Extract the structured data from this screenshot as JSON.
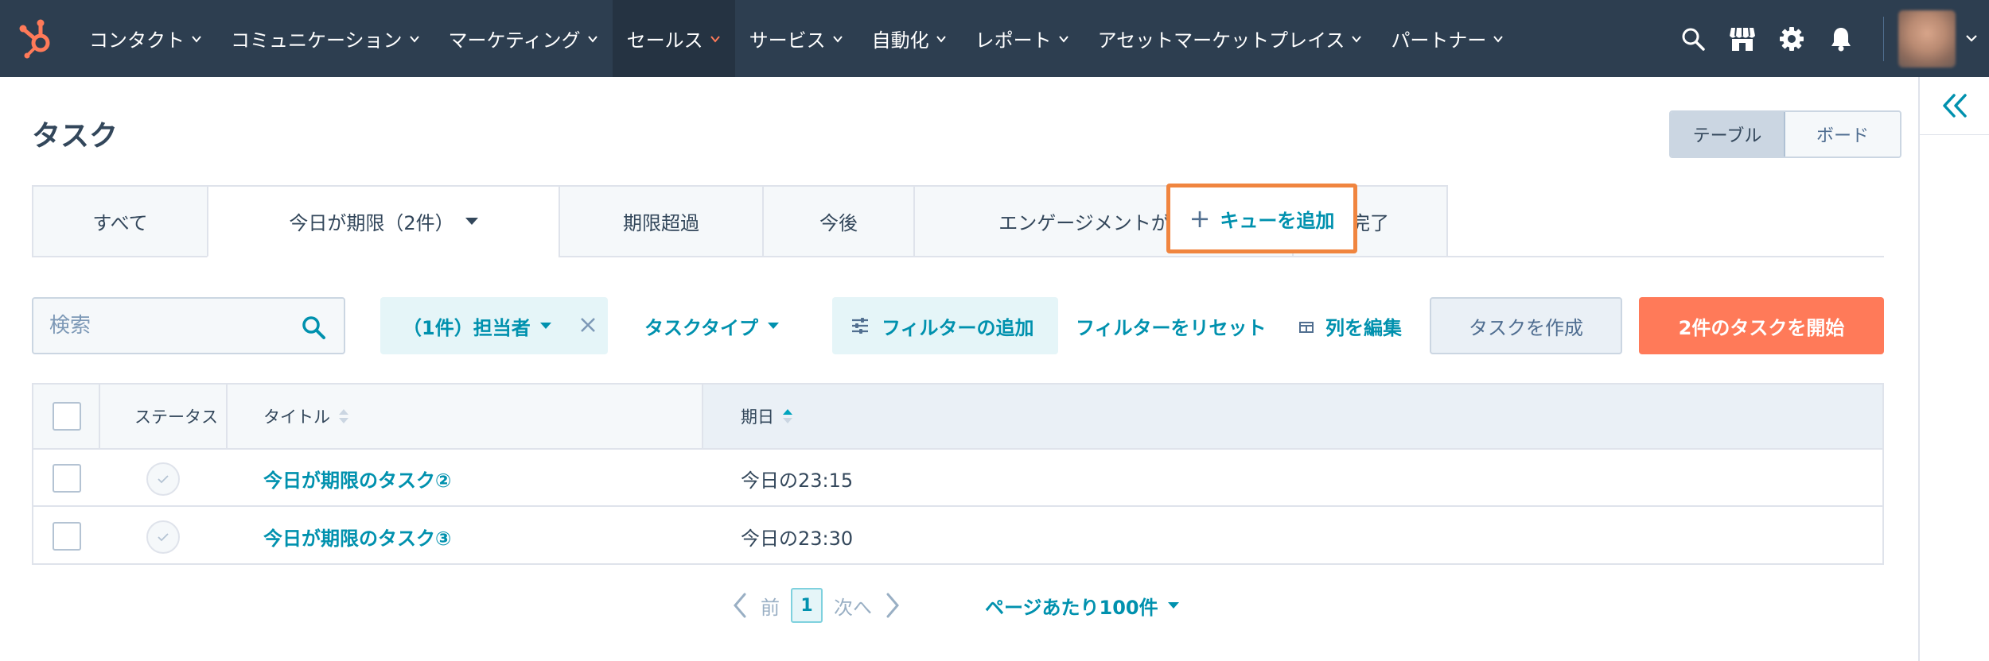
{
  "nav": {
    "items": [
      {
        "label": "コンタクト",
        "name": "nav-item-contacts",
        "active": false
      },
      {
        "label": "コミュニケーション",
        "name": "nav-item-conversations",
        "active": false
      },
      {
        "label": "マーケティング",
        "name": "nav-item-marketing",
        "active": false
      },
      {
        "label": "セールス",
        "name": "nav-item-sales",
        "active": true
      },
      {
        "label": "サービス",
        "name": "nav-item-service",
        "active": false
      },
      {
        "label": "自動化",
        "name": "nav-item-automation",
        "active": false
      },
      {
        "label": "レポート",
        "name": "nav-item-reports",
        "active": false
      },
      {
        "label": "アセットマーケットプレイス",
        "name": "nav-item-asset-marketplace",
        "active": false
      },
      {
        "label": "パートナー",
        "name": "nav-item-partner",
        "active": false
      }
    ]
  },
  "page": {
    "title": "タスク",
    "view_toggle": {
      "table": "テーブル",
      "board": "ボード"
    }
  },
  "tabs": [
    {
      "label": "すべて",
      "name": "tab-all",
      "active": false,
      "caret": false
    },
    {
      "label": "今日が期限（2件）",
      "name": "tab-due-today",
      "active": true,
      "caret": true
    },
    {
      "label": "期限超過",
      "name": "tab-overdue",
      "active": false,
      "caret": false
    },
    {
      "label": "今後",
      "name": "tab-upcoming",
      "active": false,
      "caret": false
    },
    {
      "label": "エンゲージメントが活発",
      "name": "tab-engaged",
      "active": false,
      "caret": false
    },
    {
      "label": "完了",
      "name": "tab-completed",
      "active": false,
      "caret": false
    }
  ],
  "add_queue": {
    "label": "キューを追加"
  },
  "toolbar": {
    "search_placeholder": "検索",
    "owner_filter": "（1件）担当者",
    "task_type": "タスクタイプ",
    "add_filter": "フィルターの追加",
    "reset_filters": "フィルターをリセット",
    "edit_columns": "列を編集",
    "create_task": "タスクを作成",
    "start_tasks": "2件のタスクを開始"
  },
  "table": {
    "headers": {
      "status": "ステータス",
      "title": "タイトル",
      "due": "期日"
    },
    "rows": [
      {
        "title": "今日が期限のタスク②",
        "due": "今日の23:15"
      },
      {
        "title": "今日が期限のタスク③",
        "due": "今日の23:30"
      }
    ]
  },
  "pagination": {
    "prev": "前",
    "page": "1",
    "next": "次へ",
    "per_page": "ページあたり100件"
  },
  "colors": {
    "nav_bg": "#2d3e50",
    "link": "#0091ae",
    "primary": "#ff7a59",
    "highlight": "#f0853f",
    "sales_chevron": "#ff7a59"
  }
}
